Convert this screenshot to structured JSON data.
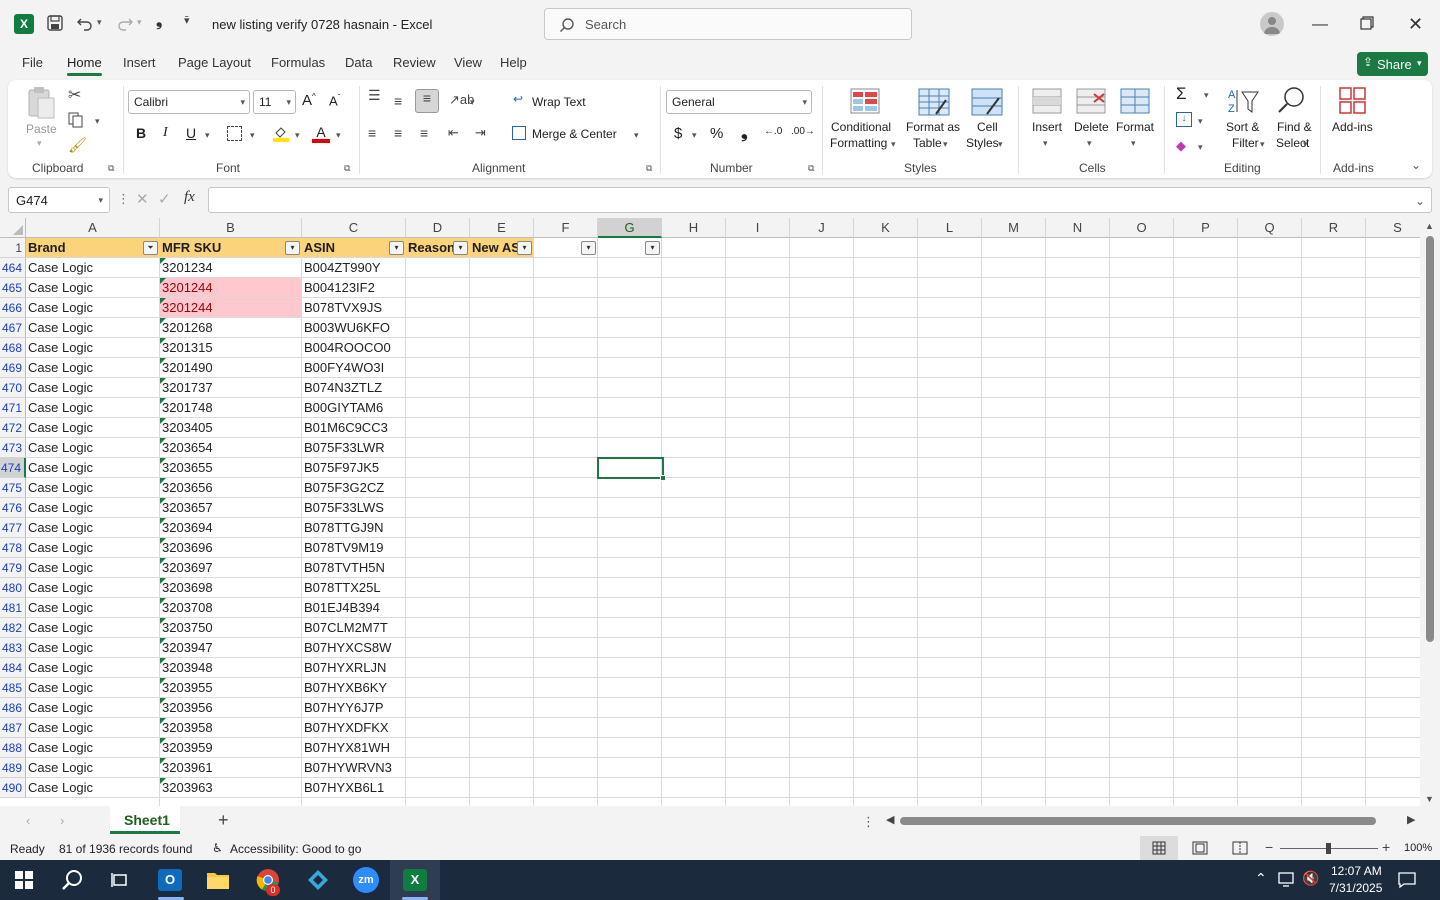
{
  "window": {
    "title": "new listing verify 0728 hasnain  -  Excel",
    "search_placeholder": "Search",
    "share_label": "Share"
  },
  "menu_tabs": [
    "File",
    "Home",
    "Insert",
    "Page Layout",
    "Formulas",
    "Data",
    "Review",
    "View",
    "Help"
  ],
  "ribbon": {
    "clipboard": {
      "paste": "Paste",
      "group": "Clipboard"
    },
    "font": {
      "name": "Calibri",
      "size": "11",
      "group": "Font"
    },
    "alignment": {
      "wrap": "Wrap Text",
      "merge": "Merge & Center",
      "group": "Alignment"
    },
    "number": {
      "format": "General",
      "group": "Number"
    },
    "styles": {
      "cond1": "Conditional",
      "cond2": "Formatting",
      "fat1": "Format as",
      "fat2": "Table",
      "cs1": "Cell",
      "cs2": "Styles",
      "group": "Styles"
    },
    "cells": {
      "insert": "Insert",
      "delete": "Delete",
      "format": "Format",
      "group": "Cells"
    },
    "editing": {
      "sort1": "Sort &",
      "sort2": "Filter",
      "find1": "Find &",
      "find2": "Select",
      "group": "Editing"
    },
    "addins": {
      "label": "Add-ins",
      "group": "Add-ins"
    }
  },
  "formula_bar": {
    "name_box": "G474",
    "fx": "fx",
    "content": ""
  },
  "columns": [
    "A",
    "B",
    "C",
    "D",
    "E",
    "F",
    "G",
    "H",
    "I",
    "J",
    "K",
    "L",
    "M",
    "N",
    "O",
    "P",
    "Q",
    "R",
    "S"
  ],
  "header_row": {
    "num": "1",
    "cells": [
      "Brand",
      "MFR SKU",
      "ASIN",
      "Reason",
      "New AS",
      "",
      ""
    ]
  },
  "rows": [
    {
      "num": "464",
      "brand": "Case Logic",
      "sku": "3201234",
      "asin": "B004ZT990Y",
      "dup": false
    },
    {
      "num": "465",
      "brand": "Case Logic",
      "sku": "3201244",
      "asin": "B004123IF2",
      "dup": true
    },
    {
      "num": "466",
      "brand": "Case Logic",
      "sku": "3201244",
      "asin": "B078TVX9JS",
      "dup": true
    },
    {
      "num": "467",
      "brand": "Case Logic",
      "sku": "3201268",
      "asin": "B003WU6KFO",
      "dup": false
    },
    {
      "num": "468",
      "brand": "Case Logic",
      "sku": "3201315",
      "asin": "B004ROOCO0",
      "dup": false
    },
    {
      "num": "469",
      "brand": "Case Logic",
      "sku": "3201490",
      "asin": "B00FY4WO3I",
      "dup": false
    },
    {
      "num": "470",
      "brand": "Case Logic",
      "sku": "3201737",
      "asin": "B074N3ZTLZ",
      "dup": false
    },
    {
      "num": "471",
      "brand": "Case Logic",
      "sku": "3201748",
      "asin": "B00GIYTAM6",
      "dup": false
    },
    {
      "num": "472",
      "brand": "Case Logic",
      "sku": "3203405",
      "asin": "B01M6C9CC3",
      "dup": false
    },
    {
      "num": "473",
      "brand": "Case Logic",
      "sku": "3203654",
      "asin": "B075F33LWR",
      "dup": false
    },
    {
      "num": "474",
      "brand": "Case Logic",
      "sku": "3203655",
      "asin": "B075F97JK5",
      "dup": false
    },
    {
      "num": "475",
      "brand": "Case Logic",
      "sku": "3203656",
      "asin": "B075F3G2CZ",
      "dup": false
    },
    {
      "num": "476",
      "brand": "Case Logic",
      "sku": "3203657",
      "asin": "B075F33LWS",
      "dup": false
    },
    {
      "num": "477",
      "brand": "Case Logic",
      "sku": "3203694",
      "asin": "B078TTGJ9N",
      "dup": false
    },
    {
      "num": "478",
      "brand": "Case Logic",
      "sku": "3203696",
      "asin": "B078TV9M19",
      "dup": false
    },
    {
      "num": "479",
      "brand": "Case Logic",
      "sku": "3203697",
      "asin": "B078TVTH5N",
      "dup": false
    },
    {
      "num": "480",
      "brand": "Case Logic",
      "sku": "3203698",
      "asin": "B078TTX25L",
      "dup": false
    },
    {
      "num": "481",
      "brand": "Case Logic",
      "sku": "3203708",
      "asin": "B01EJ4B394",
      "dup": false
    },
    {
      "num": "482",
      "brand": "Case Logic",
      "sku": "3203750",
      "asin": "B07CLM2M7T",
      "dup": false
    },
    {
      "num": "483",
      "brand": "Case Logic",
      "sku": "3203947",
      "asin": "B07HYXCS8W",
      "dup": false
    },
    {
      "num": "484",
      "brand": "Case Logic",
      "sku": "3203948",
      "asin": "B07HYXRLJN",
      "dup": false
    },
    {
      "num": "485",
      "brand": "Case Logic",
      "sku": "3203955",
      "asin": "B07HYXB6KY",
      "dup": false
    },
    {
      "num": "486",
      "brand": "Case Logic",
      "sku": "3203956",
      "asin": "B07HYY6J7P",
      "dup": false
    },
    {
      "num": "487",
      "brand": "Case Logic",
      "sku": "3203958",
      "asin": "B07HYXDFKX",
      "dup": false
    },
    {
      "num": "488",
      "brand": "Case Logic",
      "sku": "3203959",
      "asin": "B07HYX81WH",
      "dup": false
    },
    {
      "num": "489",
      "brand": "Case Logic",
      "sku": "3203961",
      "asin": "B07HYWRVN3",
      "dup": false
    },
    {
      "num": "490",
      "brand": "Case Logic",
      "sku": "3203963",
      "asin": "B07HYXB6L1",
      "dup": false
    }
  ],
  "selected_cell": "G474",
  "sheet_tabs": [
    "Sheet1"
  ],
  "status": {
    "ready": "Ready",
    "records": "81 of 1936 records found",
    "accessibility": "Accessibility: Good to go",
    "zoom": "100%"
  },
  "taskbar": {
    "time": "12:07 AM",
    "date": "7/31/2025",
    "chrome_badge": "0"
  },
  "colors": {
    "accent": "#1b7a43",
    "header_fill": "#fad37a",
    "dup_fill": "#ffc7ce",
    "dup_text": "#9c0006"
  }
}
